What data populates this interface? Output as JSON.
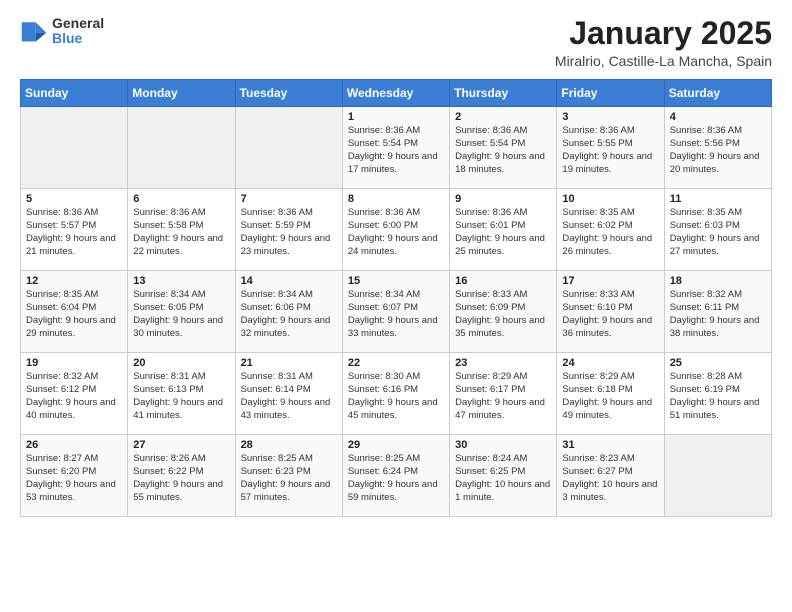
{
  "header": {
    "logo_general": "General",
    "logo_blue": "Blue",
    "calendar_title": "January 2025",
    "calendar_subtitle": "Miralrio, Castille-La Mancha, Spain"
  },
  "weekdays": [
    "Sunday",
    "Monday",
    "Tuesday",
    "Wednesday",
    "Thursday",
    "Friday",
    "Saturday"
  ],
  "weeks": [
    [
      {
        "day": "",
        "empty": true
      },
      {
        "day": "",
        "empty": true
      },
      {
        "day": "",
        "empty": true
      },
      {
        "day": "1",
        "sunrise": "8:36 AM",
        "sunset": "5:54 PM",
        "daylight": "9 hours and 17 minutes."
      },
      {
        "day": "2",
        "sunrise": "8:36 AM",
        "sunset": "5:54 PM",
        "daylight": "9 hours and 18 minutes."
      },
      {
        "day": "3",
        "sunrise": "8:36 AM",
        "sunset": "5:55 PM",
        "daylight": "9 hours and 19 minutes."
      },
      {
        "day": "4",
        "sunrise": "8:36 AM",
        "sunset": "5:56 PM",
        "daylight": "9 hours and 20 minutes."
      }
    ],
    [
      {
        "day": "5",
        "sunrise": "8:36 AM",
        "sunset": "5:57 PM",
        "daylight": "9 hours and 21 minutes."
      },
      {
        "day": "6",
        "sunrise": "8:36 AM",
        "sunset": "5:58 PM",
        "daylight": "9 hours and 22 minutes."
      },
      {
        "day": "7",
        "sunrise": "8:36 AM",
        "sunset": "5:59 PM",
        "daylight": "9 hours and 23 minutes."
      },
      {
        "day": "8",
        "sunrise": "8:36 AM",
        "sunset": "6:00 PM",
        "daylight": "9 hours and 24 minutes."
      },
      {
        "day": "9",
        "sunrise": "8:36 AM",
        "sunset": "6:01 PM",
        "daylight": "9 hours and 25 minutes."
      },
      {
        "day": "10",
        "sunrise": "8:35 AM",
        "sunset": "6:02 PM",
        "daylight": "9 hours and 26 minutes."
      },
      {
        "day": "11",
        "sunrise": "8:35 AM",
        "sunset": "6:03 PM",
        "daylight": "9 hours and 27 minutes."
      }
    ],
    [
      {
        "day": "12",
        "sunrise": "8:35 AM",
        "sunset": "6:04 PM",
        "daylight": "9 hours and 29 minutes."
      },
      {
        "day": "13",
        "sunrise": "8:34 AM",
        "sunset": "6:05 PM",
        "daylight": "9 hours and 30 minutes."
      },
      {
        "day": "14",
        "sunrise": "8:34 AM",
        "sunset": "6:06 PM",
        "daylight": "9 hours and 32 minutes."
      },
      {
        "day": "15",
        "sunrise": "8:34 AM",
        "sunset": "6:07 PM",
        "daylight": "9 hours and 33 minutes."
      },
      {
        "day": "16",
        "sunrise": "8:33 AM",
        "sunset": "6:09 PM",
        "daylight": "9 hours and 35 minutes."
      },
      {
        "day": "17",
        "sunrise": "8:33 AM",
        "sunset": "6:10 PM",
        "daylight": "9 hours and 36 minutes."
      },
      {
        "day": "18",
        "sunrise": "8:32 AM",
        "sunset": "6:11 PM",
        "daylight": "9 hours and 38 minutes."
      }
    ],
    [
      {
        "day": "19",
        "sunrise": "8:32 AM",
        "sunset": "6:12 PM",
        "daylight": "9 hours and 40 minutes."
      },
      {
        "day": "20",
        "sunrise": "8:31 AM",
        "sunset": "6:13 PM",
        "daylight": "9 hours and 41 minutes."
      },
      {
        "day": "21",
        "sunrise": "8:31 AM",
        "sunset": "6:14 PM",
        "daylight": "9 hours and 43 minutes."
      },
      {
        "day": "22",
        "sunrise": "8:30 AM",
        "sunset": "6:16 PM",
        "daylight": "9 hours and 45 minutes."
      },
      {
        "day": "23",
        "sunrise": "8:29 AM",
        "sunset": "6:17 PM",
        "daylight": "9 hours and 47 minutes."
      },
      {
        "day": "24",
        "sunrise": "8:29 AM",
        "sunset": "6:18 PM",
        "daylight": "9 hours and 49 minutes."
      },
      {
        "day": "25",
        "sunrise": "8:28 AM",
        "sunset": "6:19 PM",
        "daylight": "9 hours and 51 minutes."
      }
    ],
    [
      {
        "day": "26",
        "sunrise": "8:27 AM",
        "sunset": "6:20 PM",
        "daylight": "9 hours and 53 minutes."
      },
      {
        "day": "27",
        "sunrise": "8:26 AM",
        "sunset": "6:22 PM",
        "daylight": "9 hours and 55 minutes."
      },
      {
        "day": "28",
        "sunrise": "8:25 AM",
        "sunset": "6:23 PM",
        "daylight": "9 hours and 57 minutes."
      },
      {
        "day": "29",
        "sunrise": "8:25 AM",
        "sunset": "6:24 PM",
        "daylight": "9 hours and 59 minutes."
      },
      {
        "day": "30",
        "sunrise": "8:24 AM",
        "sunset": "6:25 PM",
        "daylight": "10 hours and 1 minute."
      },
      {
        "day": "31",
        "sunrise": "8:23 AM",
        "sunset": "6:27 PM",
        "daylight": "10 hours and 3 minutes."
      },
      {
        "day": "",
        "empty": true
      }
    ]
  ],
  "labels": {
    "sunrise_prefix": "Sunrise: ",
    "sunset_prefix": "Sunset: ",
    "daylight_prefix": "Daylight: "
  }
}
